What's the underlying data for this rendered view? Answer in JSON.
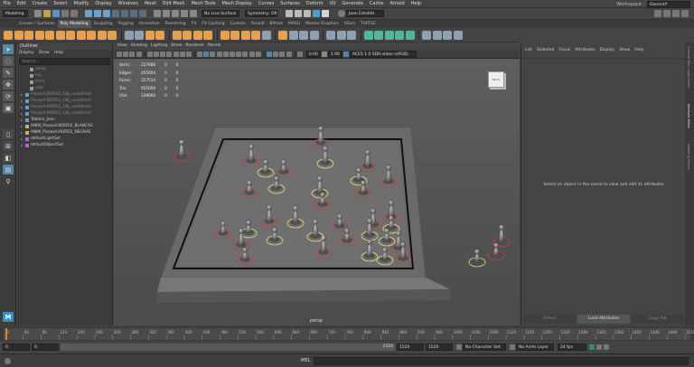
{
  "menubar": {
    "items": [
      "File",
      "Edit",
      "Create",
      "Select",
      "Modify",
      "Display",
      "Windows",
      "Mesh",
      "Edit Mesh",
      "Mesh Tools",
      "Mesh Display",
      "Curves",
      "Surfaces",
      "Deform",
      "UV",
      "Generate",
      "Cache",
      "Arnold",
      "Help"
    ],
    "workspace_label": "Workspace :",
    "workspace_value": "General*"
  },
  "statusline": {
    "mode": "Modeling",
    "live_surface": "No Live Surface",
    "symmetry": "Symmetry: Off",
    "user": "Joan Estellés"
  },
  "shelf_tabs": [
    "Curves / Surfaces",
    "Poly Modeling",
    "Sculpting",
    "Rigging",
    "Animation",
    "Rendering",
    "FX",
    "FX Caching",
    "Custom",
    "Arnold",
    "Bifrost",
    "MASH",
    "Motion Graphics",
    "XGen",
    "TURTLE"
  ],
  "shelf_active_index": 1,
  "outliner": {
    "title": "Outliner",
    "menu": [
      "Display",
      "Show",
      "Help"
    ],
    "search_placeholder": "Search...",
    "items": [
      {
        "label": "persp",
        "dim": true,
        "icon": "camera-icon"
      },
      {
        "label": "top",
        "dim": true,
        "icon": "camera-icon"
      },
      {
        "label": "front",
        "dim": true,
        "icon": "camera-icon"
      },
      {
        "label": "side",
        "dim": true,
        "icon": "camera-icon"
      },
      {
        "label": "PiezasA:BORD2_OBJ_undefined",
        "dim": true,
        "icon": "mesh-icon"
      },
      {
        "label": "PiezasA:BORD2_OBJ_undefined",
        "dim": true,
        "icon": "mesh-icon"
      },
      {
        "label": "PiezasA:BORD2_OBJ_undefined",
        "dim": true,
        "icon": "mesh-icon"
      },
      {
        "label": "PiezasA:BORD2_OBJ_undefined",
        "dim": true,
        "icon": "mesh-icon"
      },
      {
        "label": "Tablero_Joan",
        "dim": false,
        "icon": "mesh-icon"
      },
      {
        "label": "ANIM_PiezasA:BORD2_BLANCAS",
        "dim": false,
        "icon": "group-icon"
      },
      {
        "label": "ANIM_PiezasA:BORD2_NEGRAS",
        "dim": false,
        "icon": "group-icon"
      },
      {
        "label": "defaultLightSet",
        "dim": false,
        "icon": "set-icon"
      },
      {
        "label": "defaultObjectSet",
        "dim": false,
        "icon": "set-icon"
      }
    ]
  },
  "viewport": {
    "menu": [
      "View",
      "Shading",
      "Lighting",
      "Show",
      "Renderer",
      "Panels"
    ],
    "camera_label": "persp",
    "exposure": "0.00",
    "gamma": "1.00",
    "colorspace": "ACES 1.0 SDR-video (sRGB)",
    "hud": [
      {
        "label": "Verts:",
        "v1": "227686",
        "v2": "0",
        "v3": "0"
      },
      {
        "label": "Edges:",
        "v1": "455004",
        "v2": "0",
        "v3": "0"
      },
      {
        "label": "Faces:",
        "v1": "227514",
        "v2": "0",
        "v3": "0"
      },
      {
        "label": "Tris:",
        "v1": "455000",
        "v2": "0",
        "v3": "0"
      },
      {
        "label": "UVs:",
        "v1": "238060",
        "v2": "0",
        "v3": "0"
      }
    ]
  },
  "attribute_editor": {
    "menu": [
      "List",
      "Selected",
      "Focus",
      "Attributes",
      "Display",
      "Show",
      "Help"
    ],
    "message": "Select an object in the scene to view and edit its attributes",
    "buttons": [
      "Select",
      "Load Attributes",
      "Copy Tab"
    ]
  },
  "timeline": {
    "ticks": [
      "0",
      "40",
      "80",
      "120",
      "160",
      "200",
      "240",
      "280",
      "320",
      "360",
      "400",
      "440",
      "480",
      "520",
      "560",
      "600",
      "640",
      "680",
      "720",
      "760",
      "800",
      "840",
      "880",
      "920",
      "960",
      "1000",
      "1040",
      "1080",
      "1120",
      "1160",
      "1200",
      "1240",
      "1280",
      "1320",
      "1360",
      "1400",
      "1440",
      "1480",
      "1520"
    ],
    "current_frame": "1"
  },
  "range": {
    "start": "0",
    "start_inner": "0",
    "end_inner": "1520",
    "end": "1520",
    "end2": "1520",
    "character_set": "No Character Set",
    "anim_layer": "No Anim Layer",
    "fps": "24 fps"
  },
  "cmdline": {
    "label": "MEL"
  },
  "side_strip": [
    "Channel Box / Layer Editor",
    "Attribute Editor",
    "Modeling Toolkit"
  ],
  "colors": {
    "accent_blue": "#5285a6",
    "shelf_orange": "#e8a14b",
    "outline_red": "#c83a3a",
    "outline_yellow": "#e8e070",
    "playhead_orange": "#e67e22"
  }
}
